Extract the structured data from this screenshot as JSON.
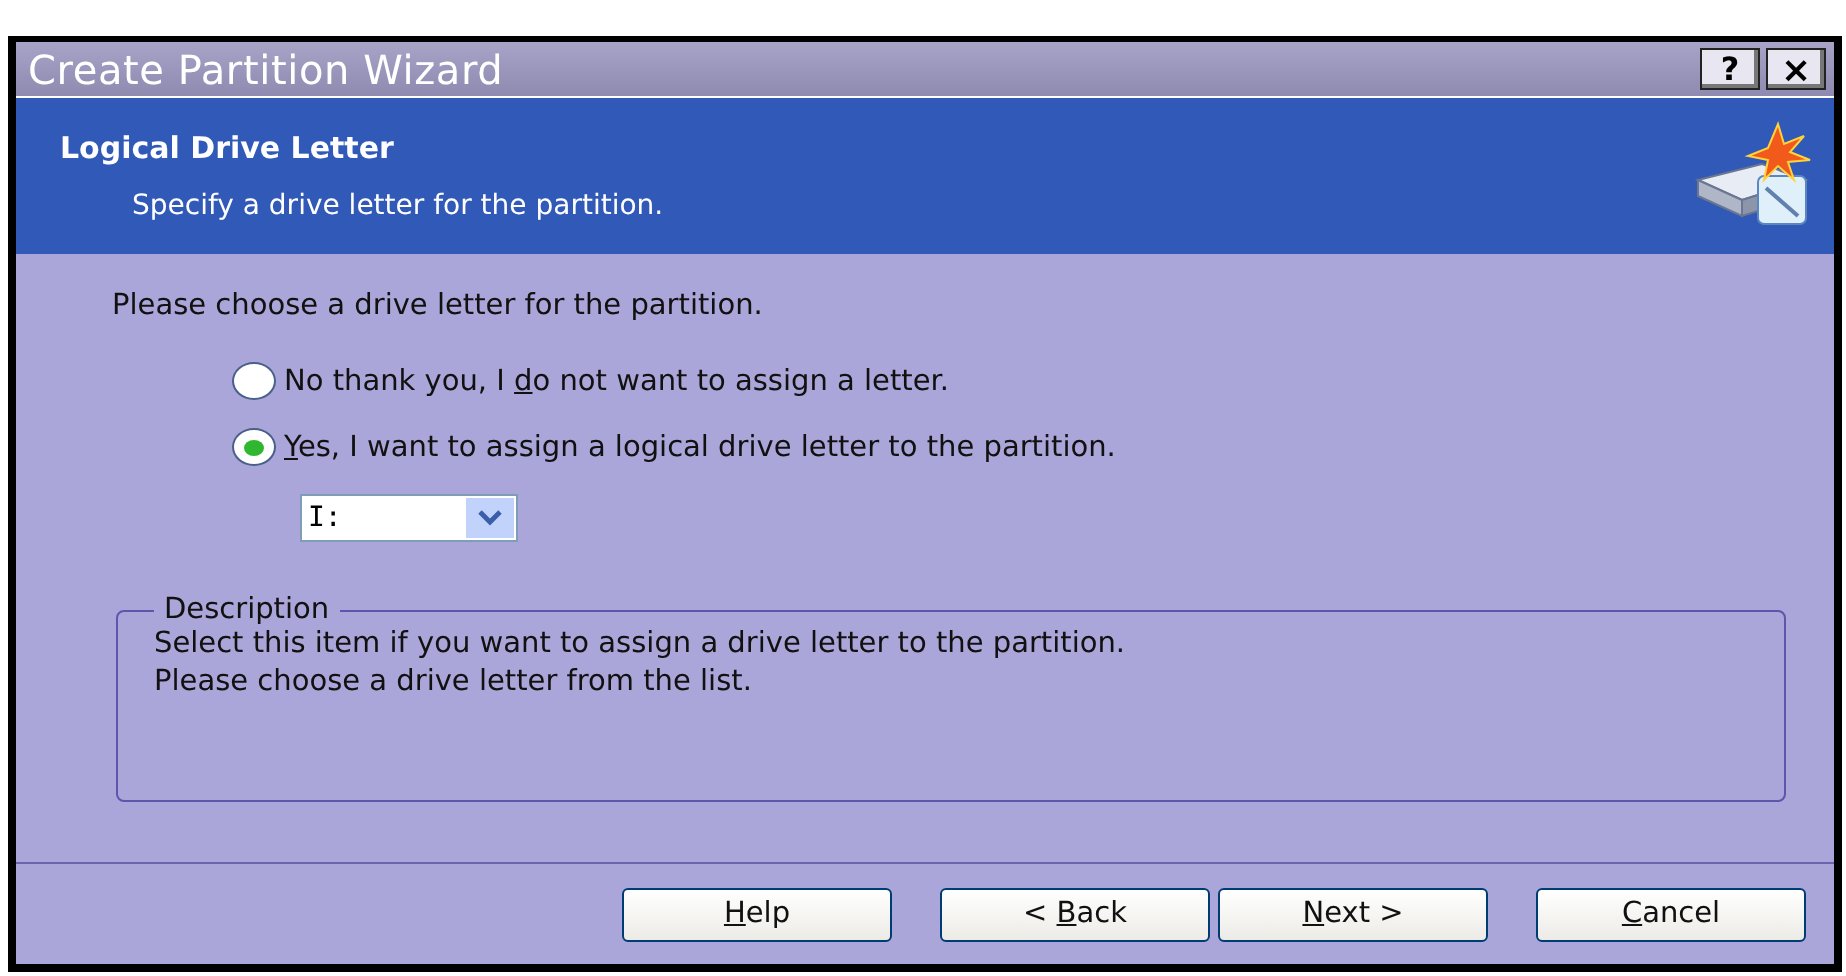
{
  "window": {
    "title": "Create Partition Wizard",
    "title_buttons": [
      {
        "kind": "help",
        "label": "?"
      },
      {
        "kind": "close",
        "label": "×"
      }
    ]
  },
  "header": {
    "title": "Logical Drive Letter",
    "subtitle": "Specify a drive letter for the partition."
  },
  "prompt": "Please choose a drive letter for the partition.",
  "options": [
    {
      "pre": "No thank you, I ",
      "key": "d",
      "post": "o not want to assign a letter.",
      "selected": false
    },
    {
      "key": "Y",
      "post": "es, I want to assign a logical drive letter to the partition.",
      "selected": true
    }
  ],
  "drive_select": {
    "value": "I:"
  },
  "description": {
    "legend": "Description",
    "lines": [
      "Select this item if you want to assign a drive letter to the partition.",
      "Please choose a drive letter from the list."
    ]
  },
  "buttons": [
    {
      "key": "H",
      "post": "elp"
    },
    {
      "pre": "< ",
      "key": "B",
      "post": "ack"
    },
    {
      "key": "N",
      "post": "ext >"
    },
    {
      "key": "C",
      "post": "ancel"
    }
  ]
}
